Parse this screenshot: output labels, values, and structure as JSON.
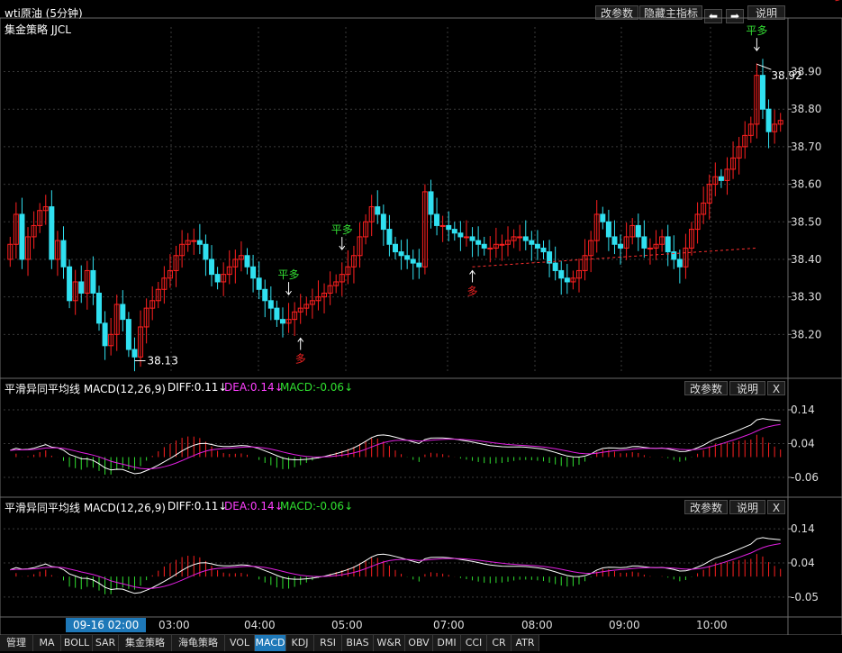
{
  "window": {
    "title": "wti原油 (5分钟)",
    "buttons": [
      "改参数",
      "隐藏主指标",
      "说明"
    ]
  },
  "main": {
    "indicator": "集金策略 JJCL",
    "high_label": "38.92",
    "low_label": "38.13",
    "signals": [
      {
        "idx": 47,
        "text": "平多",
        "dir": "down",
        "pos": "above",
        "color": "#33dd33"
      },
      {
        "idx": 49,
        "text": "多",
        "dir": "up",
        "pos": "below",
        "color": "#ee2222"
      },
      {
        "idx": 56,
        "text": "平多",
        "dir": "down",
        "pos": "above",
        "color": "#33dd33"
      },
      {
        "idx": 78,
        "text": "多",
        "dir": "up",
        "pos": "below",
        "color": "#ee2222"
      },
      {
        "idx": 126,
        "text": "平多",
        "dir": "down",
        "pos": "above",
        "color": "#33dd33"
      },
      {
        "idx": 140,
        "text": "多",
        "dir": "up",
        "pos": "below",
        "color": "#ee2222"
      }
    ]
  },
  "panels": [
    {
      "title": "平滑异同平均线 MACD(12,26,9)",
      "diff": "DIFF:0.11↓",
      "dea": "DEA:0.14↓",
      "macd": "MACD:-0.06↓",
      "buttons": [
        "改参数",
        "说明",
        "X"
      ],
      "ticks": [
        "0.14",
        "0.04",
        "-0.06"
      ]
    },
    {
      "title": "平滑异同平均线 MACD(12,26,9)",
      "diff": "DIFF:0.11↓",
      "dea": "DEA:0.14↓",
      "macd": "MACD:-0.06↓",
      "buttons": [
        "改参数",
        "说明",
        "X"
      ],
      "ticks": [
        "0.14",
        "0.04",
        "-0.05"
      ]
    }
  ],
  "xaxis": {
    "cursor_label": "09-16 02:00",
    "labels": [
      "03:00",
      "04:00",
      "05:00",
      "07:00",
      "08:00",
      "09:00",
      "10:00"
    ]
  },
  "tabs": [
    {
      "label": "管理"
    },
    {
      "label": "MA"
    },
    {
      "label": "BOLL"
    },
    {
      "label": "SAR"
    },
    {
      "label": "集金策略"
    },
    {
      "label": "海龟策略"
    },
    {
      "label": "VOL"
    },
    {
      "label": "MACD",
      "active": true
    },
    {
      "label": "KDJ"
    },
    {
      "label": "RSI"
    },
    {
      "label": "BIAS"
    },
    {
      "label": "W&R"
    },
    {
      "label": "OBV"
    },
    {
      "label": "DMI"
    },
    {
      "label": "CCI"
    },
    {
      "label": "CR"
    },
    {
      "label": "ATR"
    }
  ],
  "colors": {
    "up": "#ff2020",
    "down": "#30e0f0",
    "diff": "#ffffff",
    "dea": "#e020e0",
    "hist_up": "#ff2020",
    "hist_down": "#30e030",
    "grid": "#3a3a3a",
    "axis": "#5a5a5a",
    "dotted_line": "#ff3030"
  },
  "chart_data": [
    {
      "type": "candlestick",
      "title": "wti原油 (5分钟)",
      "ylabel": "",
      "yticks": [
        38.2,
        38.3,
        38.4,
        38.5,
        38.6,
        38.7,
        38.8,
        38.9
      ],
      "ylim": [
        38.1,
        38.99
      ],
      "x_ticks": [
        "09-16 02:00",
        "03:00",
        "04:00",
        "05:00",
        "07:00",
        "08:00",
        "09:00",
        "10:00"
      ],
      "marked_high": 38.92,
      "marked_low": 38.13,
      "close": [
        38.44,
        38.52,
        38.4,
        38.46,
        38.49,
        38.53,
        38.54,
        38.4,
        38.45,
        38.38,
        38.29,
        38.34,
        38.31,
        38.37,
        38.31,
        38.23,
        38.17,
        38.2,
        38.28,
        38.24,
        38.16,
        38.14,
        38.22,
        38.27,
        38.29,
        38.32,
        38.35,
        38.37,
        38.41,
        38.44,
        38.45,
        38.45,
        38.44,
        38.4,
        38.36,
        38.34,
        38.36,
        38.38,
        38.4,
        38.41,
        38.38,
        38.35,
        38.32,
        38.29,
        38.27,
        38.24,
        38.23,
        38.24,
        38.26,
        38.27,
        38.28,
        38.29,
        38.3,
        38.31,
        38.33,
        38.34,
        38.36,
        38.38,
        38.41,
        38.46,
        38.5,
        38.54,
        38.52,
        38.48,
        38.44,
        38.42,
        38.41,
        38.4,
        38.39,
        38.38,
        38.58,
        38.52,
        38.49,
        38.49,
        38.48,
        38.47,
        38.46,
        38.46,
        38.45,
        38.44,
        38.43,
        38.43,
        38.44,
        38.44,
        38.45,
        38.46,
        38.46,
        38.45,
        38.44,
        38.43,
        38.42,
        38.39,
        38.37,
        38.35,
        38.34,
        38.35,
        38.37,
        38.41,
        38.45,
        38.52,
        38.5,
        38.46,
        38.44,
        38.43,
        38.46,
        38.49,
        38.46,
        38.43,
        38.43,
        38.44,
        38.46,
        38.42,
        38.4,
        38.38,
        38.43,
        38.48,
        38.52,
        38.55,
        38.6,
        38.62,
        38.61,
        38.64,
        38.67,
        38.7,
        38.73,
        38.76,
        38.89,
        38.8,
        38.74,
        38.76,
        38.77
      ]
    },
    {
      "type": "line+bar",
      "title": "MACD(12,26,9)",
      "series": [
        {
          "name": "DIFF",
          "last": 0.11
        },
        {
          "name": "DEA",
          "last": 0.14
        },
        {
          "name": "MACD",
          "last": -0.06
        }
      ],
      "ylim": [
        -0.1,
        0.18
      ]
    },
    {
      "type": "line+bar",
      "title": "MACD(12,26,9)",
      "series": [
        {
          "name": "DIFF",
          "last": 0.11
        },
        {
          "name": "DEA",
          "last": 0.14
        },
        {
          "name": "MACD",
          "last": -0.06
        }
      ],
      "ylim": [
        -0.1,
        0.18
      ]
    }
  ]
}
